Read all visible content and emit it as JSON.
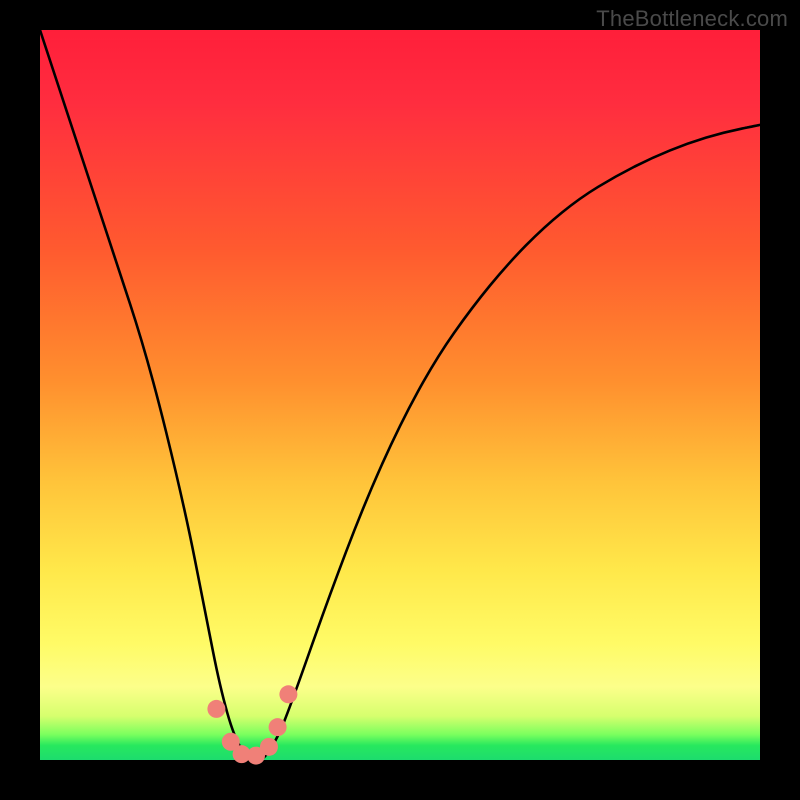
{
  "attribution": "TheBottleneck.com",
  "chart_data": {
    "type": "line",
    "title": "",
    "xlabel": "",
    "ylabel": "",
    "xlim": [
      0,
      100
    ],
    "ylim": [
      0,
      100
    ],
    "series": [
      {
        "name": "curve",
        "x": [
          0,
          5,
          10,
          15,
          20,
          23,
          25,
          27,
          29,
          30,
          31,
          33,
          35,
          40,
          45,
          50,
          55,
          60,
          65,
          70,
          75,
          80,
          85,
          90,
          95,
          100
        ],
        "values": [
          100,
          85,
          70,
          55,
          35,
          20,
          10,
          3,
          0,
          0,
          0,
          3,
          8,
          22,
          35,
          46,
          55,
          62,
          68,
          73,
          77,
          80,
          82.5,
          84.5,
          86,
          87
        ]
      }
    ],
    "markers": {
      "name": "highlight-dots",
      "color": "#f08078",
      "points": [
        {
          "x": 24.5,
          "y": 7
        },
        {
          "x": 26.5,
          "y": 2.5
        },
        {
          "x": 28.0,
          "y": 0.8
        },
        {
          "x": 30.0,
          "y": 0.6
        },
        {
          "x": 31.8,
          "y": 1.8
        },
        {
          "x": 33.0,
          "y": 4.5
        },
        {
          "x": 34.5,
          "y": 9
        }
      ]
    },
    "background_gradient": {
      "top": "#ff1f3a",
      "mid1": "#ff8f2e",
      "mid2": "#ffe84a",
      "green": "#1ddc6e"
    }
  }
}
